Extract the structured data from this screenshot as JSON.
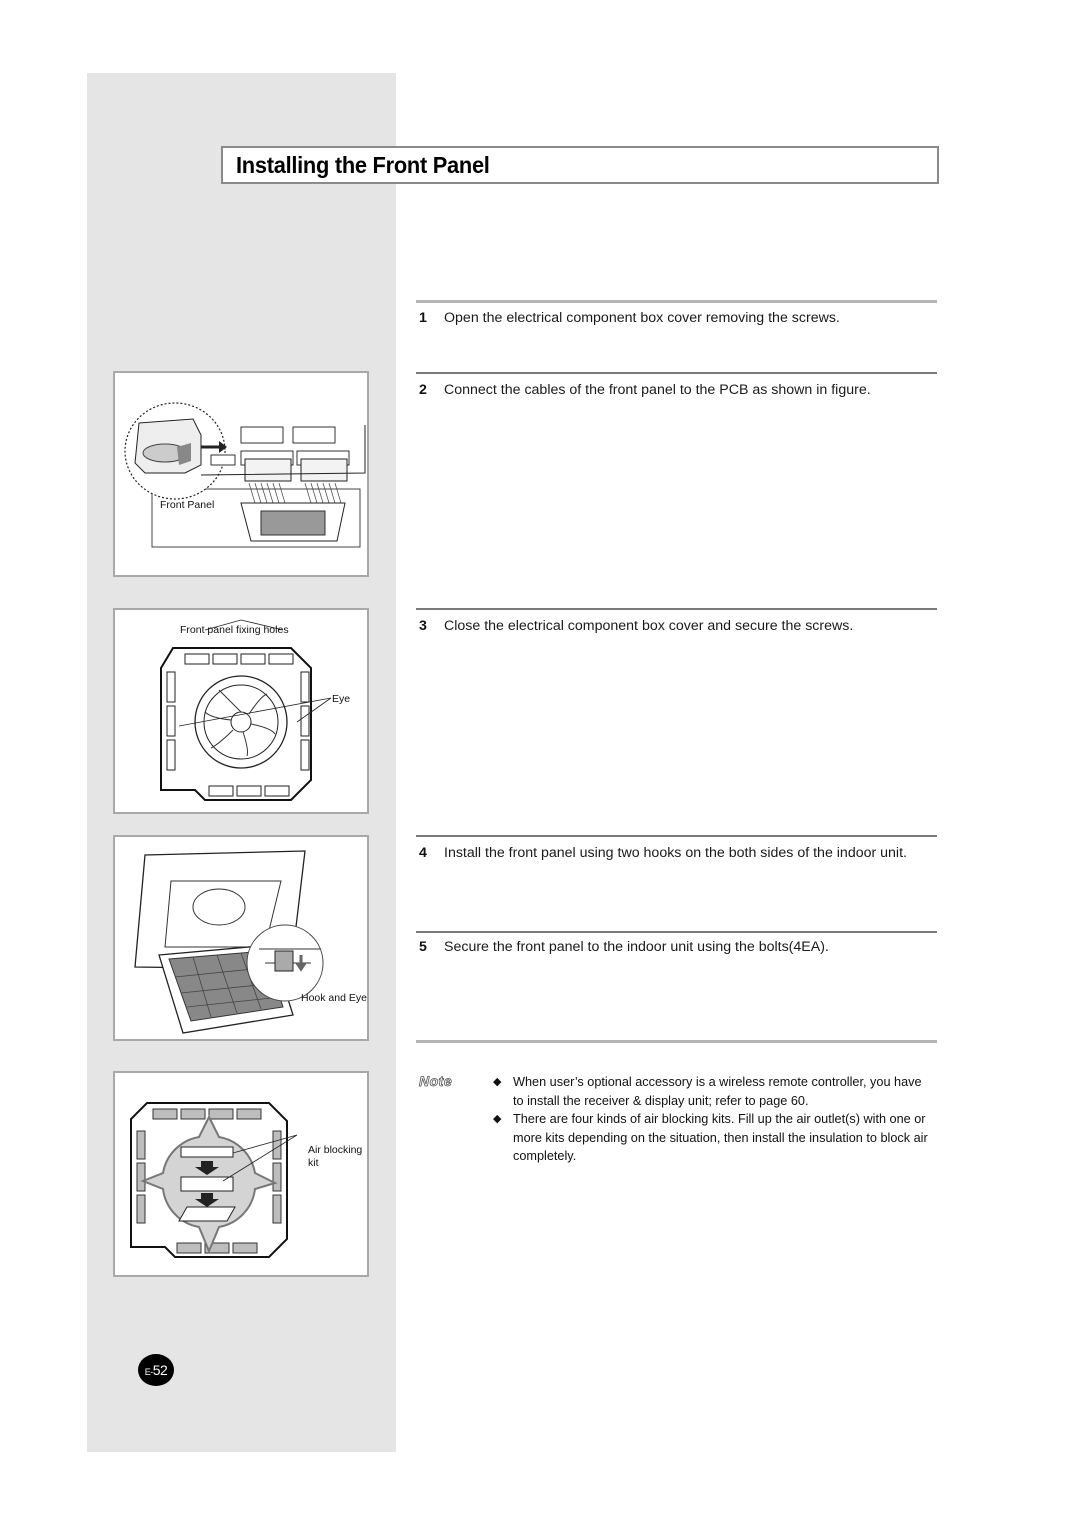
{
  "page": {
    "title": "Installing the Front Panel",
    "page_number": "E-52",
    "page_prefix": "E-",
    "page_digits": "52"
  },
  "figures": [
    {
      "id": "pcb-connection",
      "labels": [
        "Front Panel"
      ]
    },
    {
      "id": "fixing-holes",
      "labels": [
        "Front panel fixing holes",
        "Eye"
      ]
    },
    {
      "id": "hook-and-eye",
      "labels": [
        "Hook and Eye"
      ]
    },
    {
      "id": "air-blocking",
      "labels": [
        "Air blocking",
        "kit"
      ]
    }
  ],
  "steps": [
    {
      "num": "1",
      "text": "Open the electrical component box cover removing the screws."
    },
    {
      "num": "2",
      "text": "Connect the cables of the front panel to the PCB as shown in figure."
    },
    {
      "num": "3",
      "text": "Close the electrical component box cover and secure the screws."
    },
    {
      "num": "4",
      "text": "Install the front panel using two hooks on the both sides of the indoor unit."
    },
    {
      "num": "5",
      "text": "Secure the front panel to the indoor unit using the bolts(4EA)."
    }
  ],
  "note": {
    "label": "Note",
    "bullet_icon": "◆",
    "items": [
      "When user’s optional accessory is a wireless remote controller, you have to install the receiver & display unit; refer to page 60.",
      "There are four kinds of air blocking kits. Fill up the air outlet(s) with one or more kits depending on the situation, then install the insulation to block air completely."
    ]
  }
}
